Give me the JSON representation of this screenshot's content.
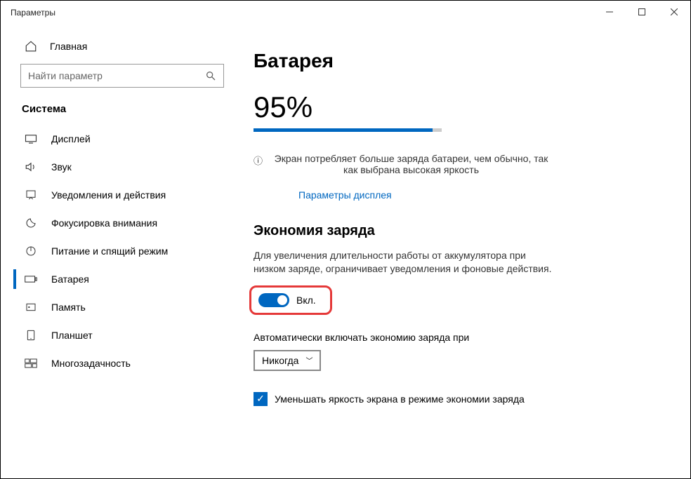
{
  "titlebar": {
    "title": "Параметры"
  },
  "sidebar": {
    "home_label": "Главная",
    "search_placeholder": "Найти параметр",
    "section": "Система",
    "items": [
      {
        "label": "Дисплей"
      },
      {
        "label": "Звук"
      },
      {
        "label": "Уведомления и действия"
      },
      {
        "label": "Фокусировка внимания"
      },
      {
        "label": "Питание и спящий режим"
      },
      {
        "label": "Батарея"
      },
      {
        "label": "Память"
      },
      {
        "label": "Планшет"
      },
      {
        "label": "Многозадачность"
      }
    ]
  },
  "main": {
    "heading": "Батарея",
    "percent_label": "95%",
    "percent_value": 95,
    "tip_text": "Экран потребляет больше заряда батареи, чем обычно, так как выбрана высокая яркость",
    "tip_link": "Параметры дисплея",
    "saver_heading": "Экономия заряда",
    "saver_desc": "Для увеличения длительности работы от аккумулятора при низком заряде, ограничивает уведомления и фоновые действия.",
    "toggle_state_label": "Вкл.",
    "auto_label": "Автоматически включать экономию заряда при",
    "select_value": "Никогда",
    "brightness_checkbox_label": "Уменьшать яркость экрана в режиме экономии заряда"
  }
}
